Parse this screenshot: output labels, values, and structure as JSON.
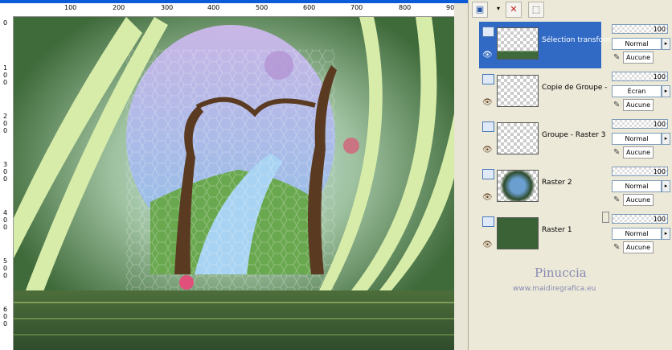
{
  "rulers": {
    "top": [
      "100",
      "200",
      "300",
      "400",
      "500",
      "600",
      "700",
      "800",
      "900"
    ],
    "left": [
      "0",
      "1\n0\n0",
      "2\n0\n0",
      "3\n0\n0",
      "4\n0\n0",
      "5\n0\n0",
      "6\n0\n0"
    ]
  },
  "layers": [
    {
      "name": "Sélection transform",
      "selected": true,
      "opacity": "100",
      "blend": "Normal",
      "mask": "Aucune"
    },
    {
      "name": "Copie de Groupe -",
      "selected": false,
      "opacity": "100",
      "blend": "Écran",
      "mask": "Aucune"
    },
    {
      "name": "Groupe - Raster 3",
      "selected": false,
      "opacity": "100",
      "blend": "Normal",
      "mask": "Aucune"
    },
    {
      "name": "Raster 2",
      "selected": false,
      "opacity": "100",
      "blend": "Normal",
      "mask": "Aucune"
    },
    {
      "name": "Raster 1",
      "selected": false,
      "opacity": "100",
      "blend": "Normal",
      "mask": "Aucune"
    }
  ],
  "watermark": {
    "title": "Pinuccia",
    "url": "www.maidiregrafica.eu"
  },
  "colors": {
    "selection": "#316ac5",
    "canvas_bg": "#3f6a3a",
    "stripe": "#d8ecaa"
  }
}
